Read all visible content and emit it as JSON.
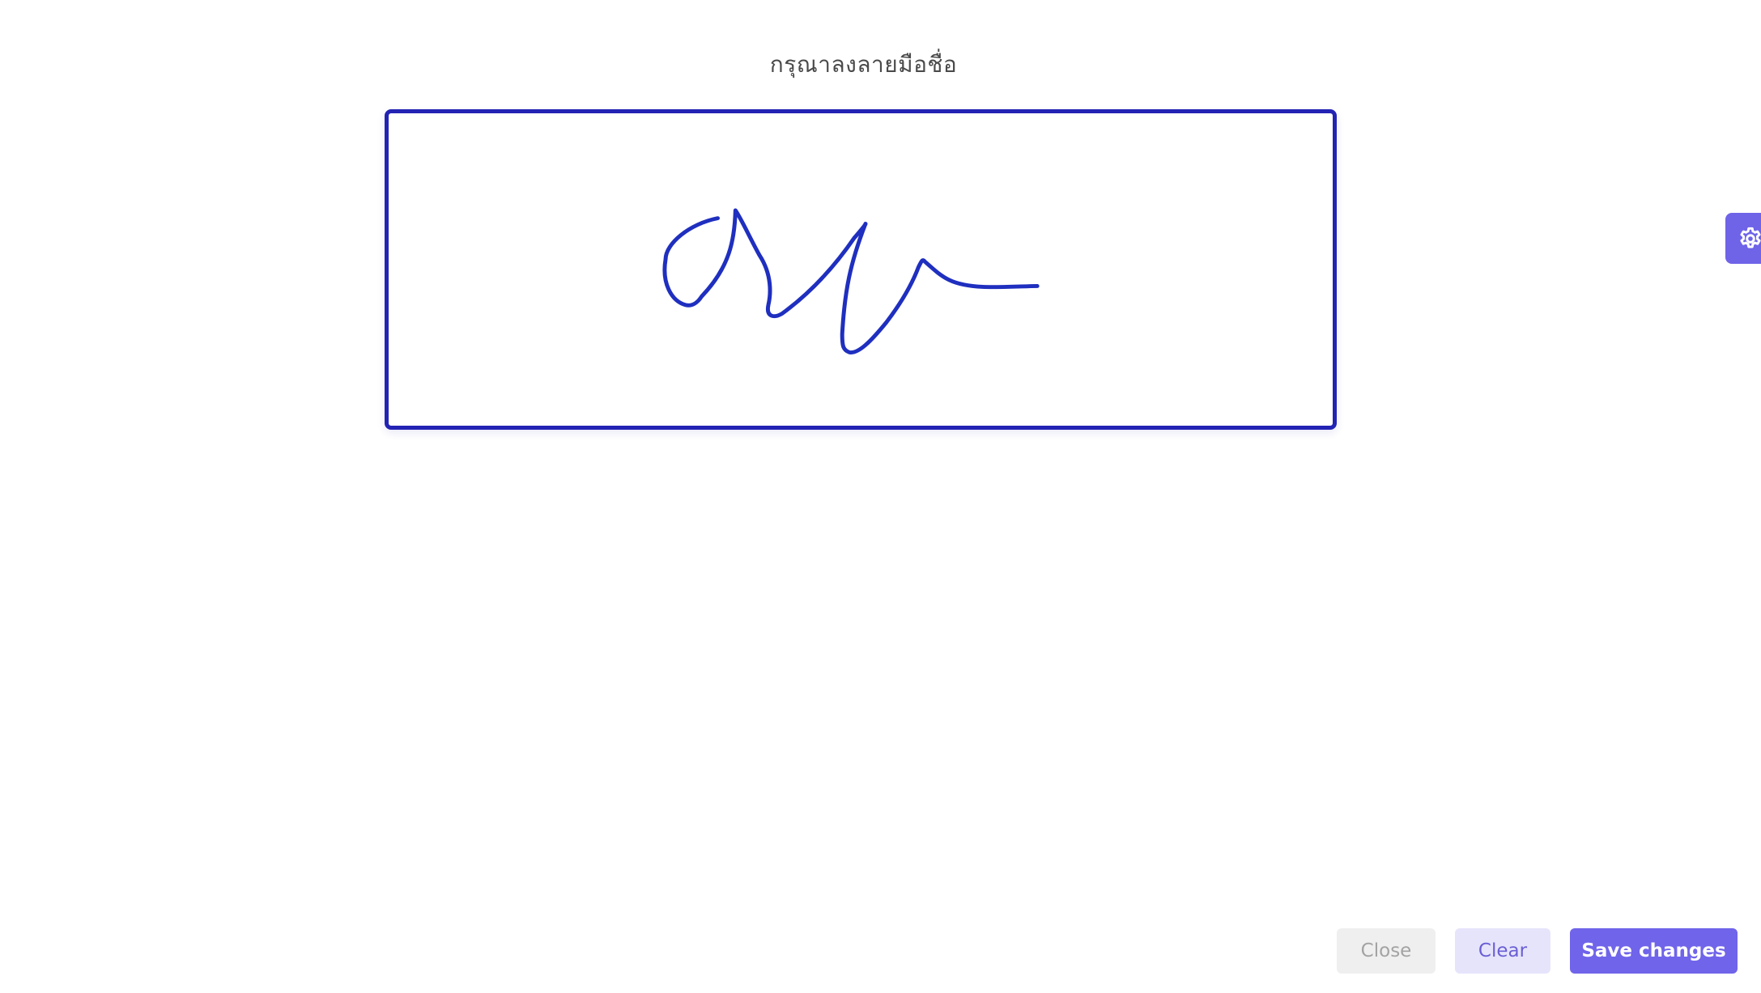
{
  "dialog": {
    "title": "กรุณาลงลายมือชื่อ"
  },
  "signature": {
    "stroke_color": "#1f2fbf",
    "border_color": "#2323b4"
  },
  "settings": {
    "icon": "gear-icon",
    "accent": "#6f63e8"
  },
  "footer": {
    "close_label": "Close",
    "clear_label": "Clear",
    "save_label": "Save changes"
  }
}
